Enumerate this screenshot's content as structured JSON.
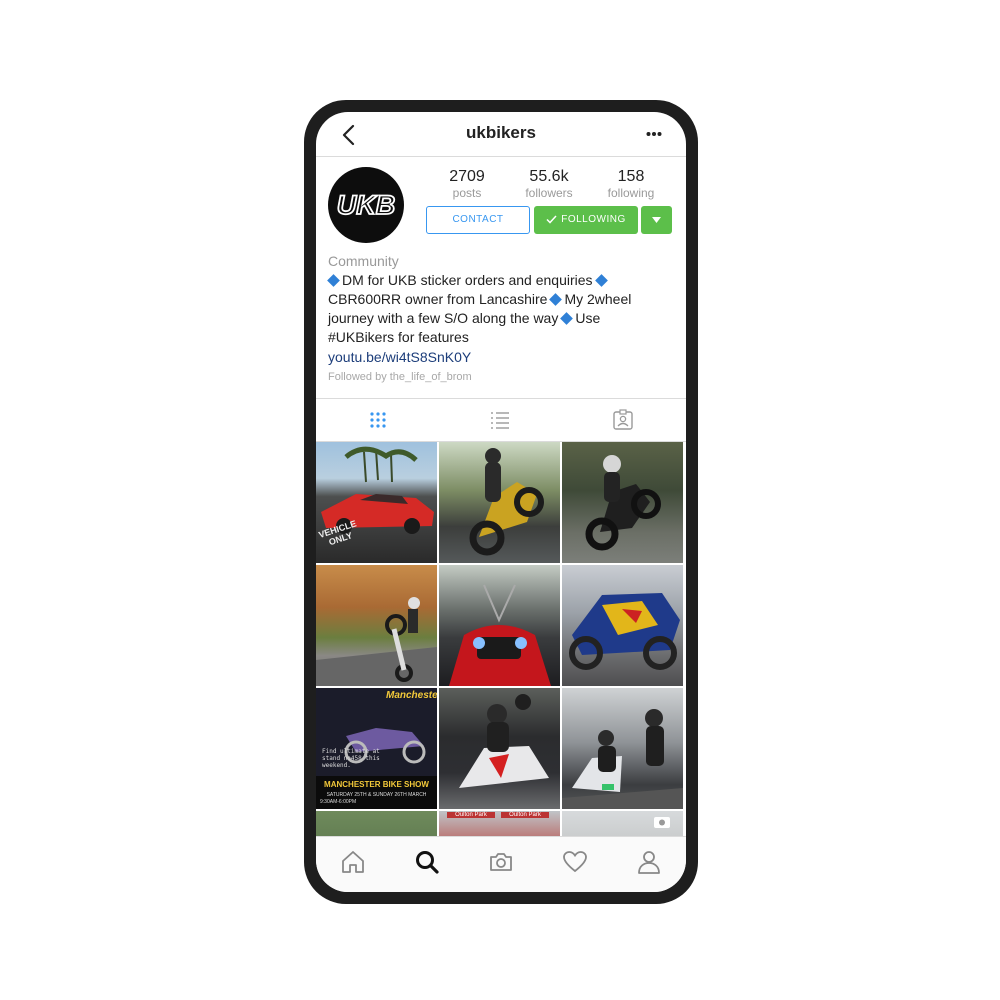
{
  "header": {
    "title": "ukbikers"
  },
  "profile": {
    "avatar_text": "UKB",
    "stats": [
      {
        "value": "2709",
        "label": "posts"
      },
      {
        "value": "55.6k",
        "label": "followers"
      },
      {
        "value": "158",
        "label": "following"
      }
    ],
    "contact_label": "CONTACT",
    "following_label": "FOLLOWING"
  },
  "bio": {
    "category": "Community",
    "line1": "DM for UKB sticker orders and enquiries",
    "line2a": "CBR600RR owner from Lancashire",
    "line2b": "My 2wheel",
    "line3a": "journey with a few S/O along the way",
    "line3b": "Use",
    "line4": "#UKBikers for features",
    "link": "youtu.be/wi4tS8SnK0Y",
    "followed_by": "Followed by the_life_of_brom"
  },
  "tabs": [
    "grid-icon",
    "list-icon",
    "tagged-icon"
  ],
  "grid": {
    "poster": {
      "brand": "Manchester",
      "note": "Find ultimate at stand no458 this weekend.",
      "show": "MANCHESTER BIKE SHOW",
      "dates": "SATURDAY 25TH & SUNDAY 26TH MARCH",
      "time": "9:30AM-6:00PM"
    },
    "parking_text": "VEHICLE ONLY",
    "sign_left": "Oulton Park",
    "sign_right": "Oulton Park"
  },
  "nav": [
    "home-icon",
    "search-icon",
    "camera-icon",
    "heart-icon",
    "profile-icon"
  ],
  "colors": {
    "accent_blue": "#3897f0",
    "following_green": "#5cbf4a",
    "frame": "#1e1e1e"
  }
}
